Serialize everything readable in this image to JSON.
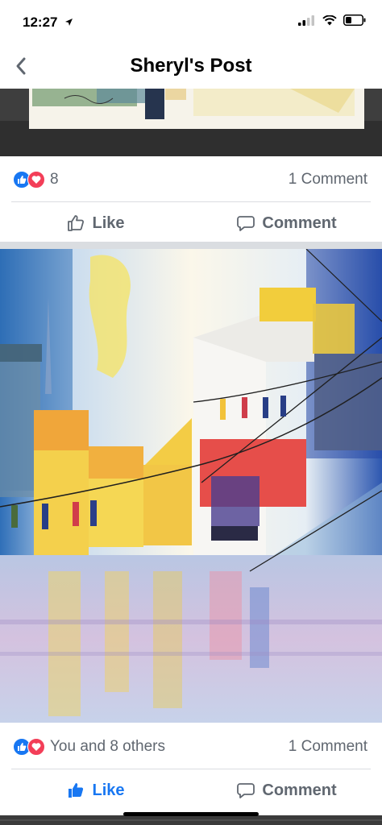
{
  "status_bar": {
    "time": "12:27",
    "icons": [
      "location-arrow-icon",
      "cellular-signal-icon",
      "wifi-icon",
      "battery-icon"
    ]
  },
  "nav": {
    "title": "Sheryl's Post",
    "back_icon": "chevron-left-icon"
  },
  "posts": [
    {
      "reactions": [
        "like-reaction-icon",
        "love-reaction-icon"
      ],
      "reaction_count": "8",
      "comment_count": "1 Comment",
      "like_label": "Like",
      "comment_label": "Comment",
      "liked": false
    },
    {
      "reactions": [
        "like-reaction-icon",
        "love-reaction-icon"
      ],
      "reaction_count": "You and 8 others",
      "comment_count": "1 Comment",
      "like_label": "Like",
      "comment_label": "Comment",
      "liked": true
    }
  ],
  "colors": {
    "accent": "#1877f2",
    "like_reaction": "#1877f2",
    "love_reaction": "#f33e58",
    "secondary_text": "#606770",
    "separator": "#dadde1"
  }
}
